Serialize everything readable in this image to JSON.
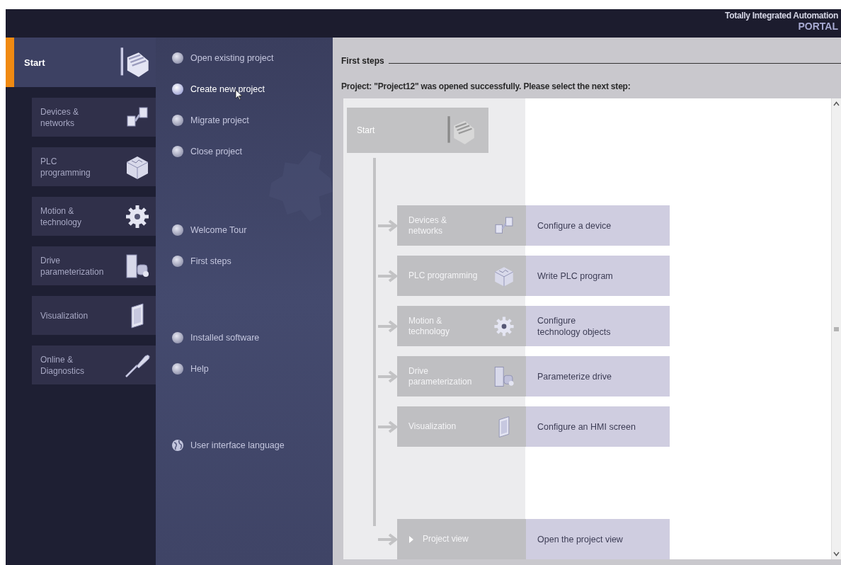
{
  "header": {
    "title": "Totally Integrated Automation",
    "subtitle": "PORTAL"
  },
  "nav": [
    {
      "label": "Start",
      "selected": true
    },
    {
      "label": "Devices & networks",
      "selected": false
    },
    {
      "label": "PLC programming",
      "selected": false
    },
    {
      "label": "Motion & technology",
      "selected": false
    },
    {
      "label": "Drive parameterization",
      "selected": false
    },
    {
      "label": "Visualization",
      "selected": false
    },
    {
      "label": "Online & Diagnostics",
      "selected": false
    }
  ],
  "action_groups": [
    {
      "items": [
        {
          "label": "Open existing project",
          "kind": "bullet",
          "selected": false
        },
        {
          "label": "Create new project",
          "kind": "bullet",
          "selected": true
        },
        {
          "label": "Migrate project",
          "kind": "bullet",
          "selected": false
        },
        {
          "label": "Close project",
          "kind": "bullet",
          "selected": false
        }
      ]
    },
    {
      "items": [
        {
          "label": "Welcome Tour",
          "kind": "bullet",
          "selected": false
        },
        {
          "label": "First steps",
          "kind": "bullet",
          "selected": false
        }
      ]
    },
    {
      "items": [
        {
          "label": "Installed software",
          "kind": "bullet",
          "selected": false
        },
        {
          "label": "Help",
          "kind": "bullet",
          "selected": false
        }
      ]
    },
    {
      "items": [
        {
          "label": "User interface language",
          "kind": "globe",
          "selected": false
        }
      ]
    }
  ],
  "main": {
    "section_title": "First steps",
    "message": "Project: \"Project12\" was opened successfully. Please select the next step:",
    "start_box": {
      "label": "Start"
    },
    "steps": [
      {
        "kind": "portal",
        "label": "Devices &\nnetworks",
        "action": "Configure a device"
      },
      {
        "kind": "portal",
        "label": "PLC programming",
        "action": "Write PLC program"
      },
      {
        "kind": "portal",
        "label": "Motion &\ntechnology",
        "action": "Configure\ntechnology objects"
      },
      {
        "kind": "portal",
        "label": "Drive\nparameterization",
        "action": "Parameterize drive"
      },
      {
        "kind": "portal",
        "label": "Visualization",
        "action": "Configure an HMI screen"
      },
      {
        "kind": "project_view",
        "label": "Project view",
        "action": "Open the project view"
      }
    ]
  }
}
